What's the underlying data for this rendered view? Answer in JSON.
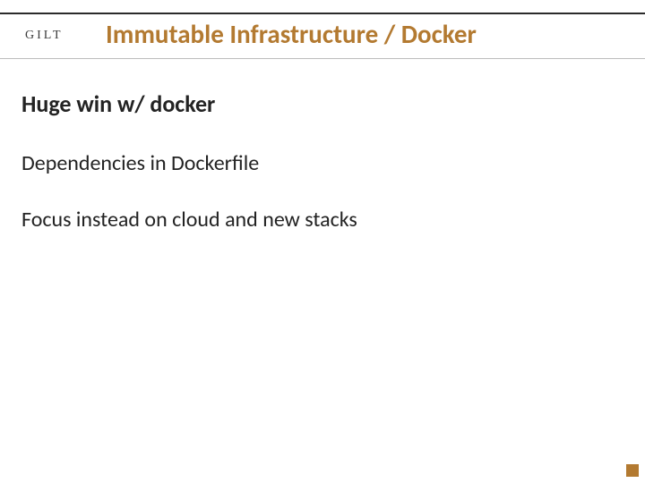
{
  "header": {
    "logo_text": "GILT",
    "title": "Immutable Infrastructure / Docker"
  },
  "content": {
    "subheading": "Huge win w/ docker",
    "lines": [
      "Dependencies in Dockerfile",
      "Focus instead on cloud and new stacks"
    ]
  },
  "colors": {
    "accent": "#b37a31",
    "text": "#232323",
    "rule_dark": "#2b2b2b",
    "rule_light": "#bcbcbc"
  }
}
